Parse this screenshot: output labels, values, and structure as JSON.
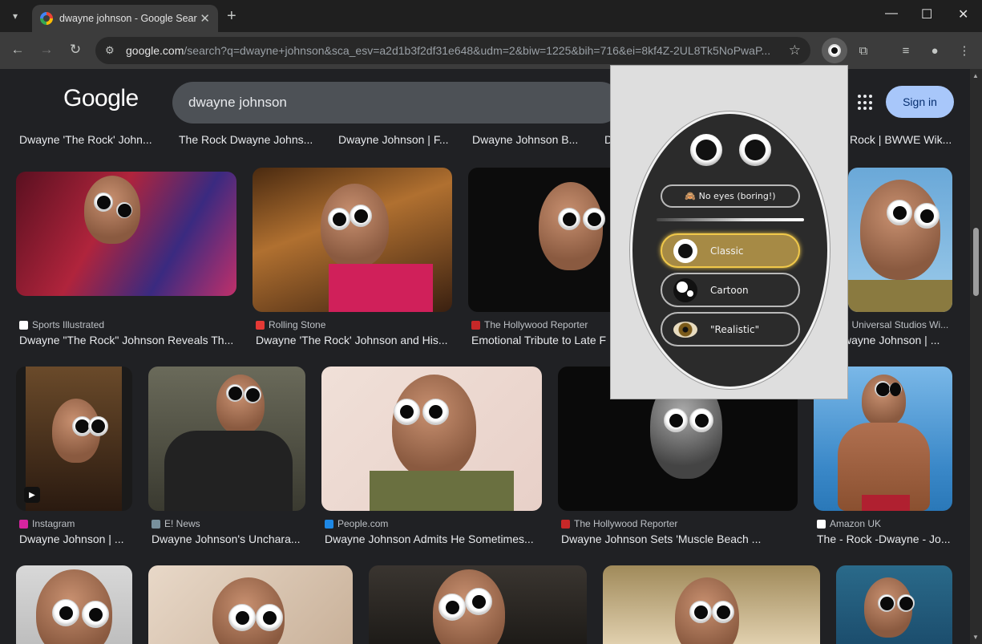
{
  "browser": {
    "tab_title": "dwayne johnson - Google Search",
    "tab_close": "✕",
    "new_tab": "+",
    "url_main": "google.com",
    "url_rest": "/search?q=dwayne+johnson&sca_esv=a2d1b3f2df31e648&udm=2&biw=1225&bih=716&ei=8kf4Z-2UL8Tk5NoPwaP...",
    "icons": [
      "back-icon",
      "forward-icon",
      "reload-icon",
      "site-info-icon",
      "star-icon",
      "extension-icon",
      "puzzle-icon",
      "media-icon",
      "profile-icon",
      "menu-icon"
    ]
  },
  "google": {
    "logo": "Google",
    "query": "dwayne johnson",
    "signin": "Sign in"
  },
  "prev_row": [
    "Dwayne 'The Rock' John...",
    "The Rock Dwayne Johns...",
    "Dwayne Johnson | F...",
    "Dwayne Johnson B...",
    "D",
    "Rock | BWWE Wik..."
  ],
  "results": [
    {
      "source": "Sports Illustrated",
      "caption": "Dwayne \"The Rock\" Johnson Reveals Th..."
    },
    {
      "source": "Rolling Stone",
      "caption": "Dwayne 'The Rock' Johnson and His..."
    },
    {
      "source": "The Hollywood Reporter",
      "caption": "Emotional Tribute to Late F"
    },
    {
      "source": "| Universal Studios Wi...",
      "caption": "wayne Johnson | ..."
    },
    {
      "source": "Instagram",
      "caption": "Dwayne Johnson | ..."
    },
    {
      "source": "E! News",
      "caption": "Dwayne Johnson's Uncharа..."
    },
    {
      "source": "People.com",
      "caption": "Dwayne Johnson Admits He Sometimes..."
    },
    {
      "source": "The Hollywood Reporter",
      "caption": "Dwayne Johnson Sets 'Muscle Beach ..."
    },
    {
      "source": "Amazon UK",
      "caption": "The - Rock -Dwayne - Jo..."
    }
  ],
  "popup": {
    "no_eyes": "🙈 No eyes (boring!)",
    "classic": "Classic",
    "cartoon": "Cartoon",
    "realistic": "\"Realistic\"",
    "selected": "Classic",
    "accent": "#f0c84a"
  }
}
